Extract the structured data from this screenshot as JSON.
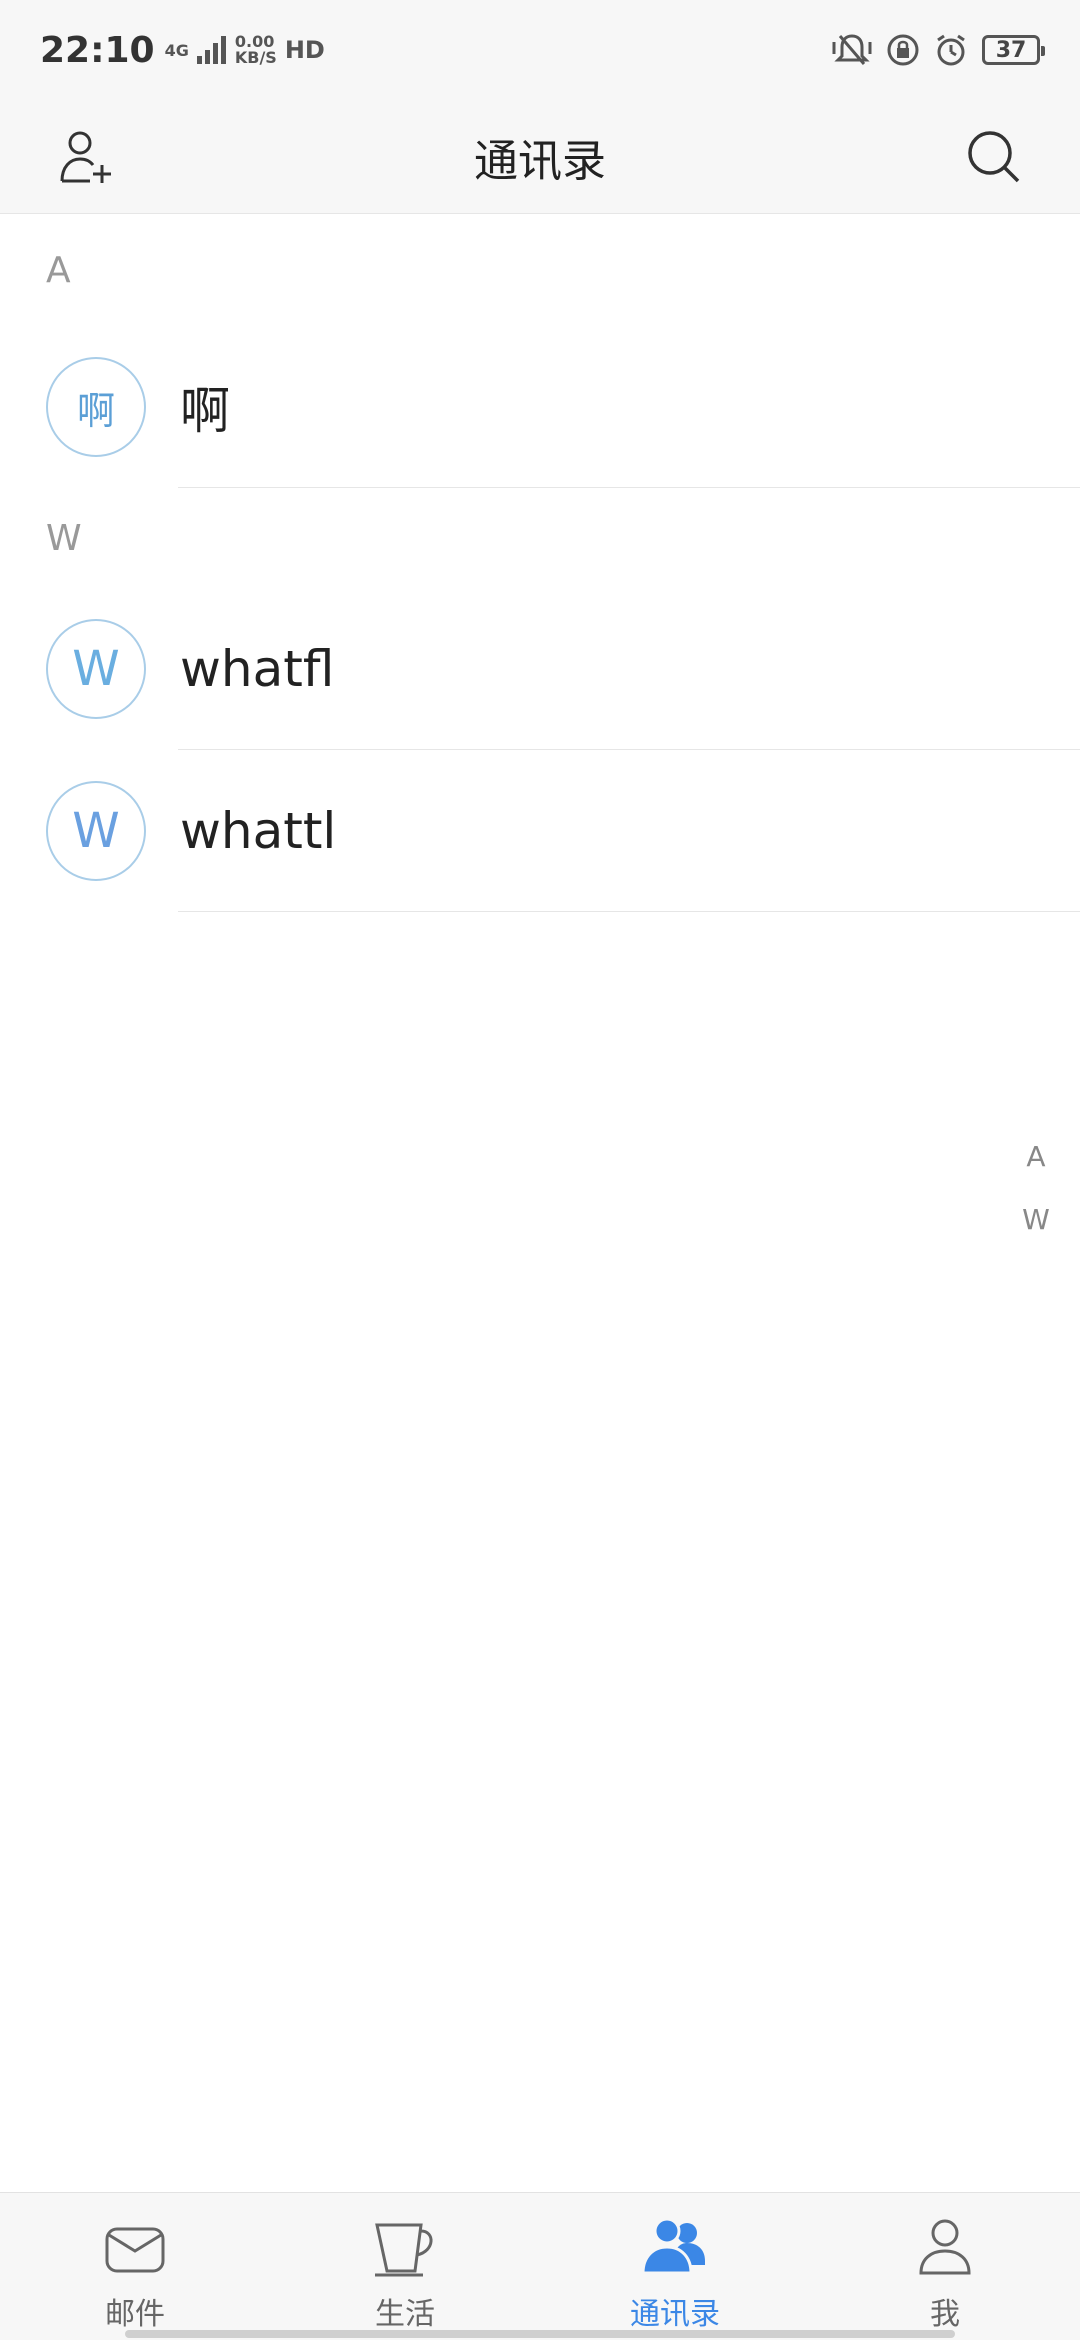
{
  "status_bar": {
    "time": "22:10",
    "network": "4G",
    "speed_value": "0.00",
    "speed_unit": "KB/S",
    "hd": "HD",
    "battery": "37"
  },
  "header": {
    "title": "通讯录",
    "add_contact_icon": "add-person-icon",
    "search_icon": "search-icon"
  },
  "contacts": {
    "sections": [
      {
        "letter": "A",
        "items": [
          {
            "avatar": "啊",
            "name": "啊"
          }
        ]
      },
      {
        "letter": "W",
        "items": [
          {
            "avatar": "W",
            "name": "whatfl"
          },
          {
            "avatar": "W",
            "name": "whattl"
          }
        ]
      }
    ]
  },
  "index_bar": [
    "A",
    "W"
  ],
  "bottom_nav": {
    "items": [
      {
        "label": "邮件",
        "icon": "mail-icon"
      },
      {
        "label": "生活",
        "icon": "cup-icon"
      },
      {
        "label": "通讯录",
        "icon": "contacts-icon",
        "active": true
      },
      {
        "label": "我",
        "icon": "person-icon"
      }
    ]
  },
  "colors": {
    "accent": "#3b87e6",
    "avatar_border": "#a9cde8",
    "avatar_text": "#5b9fd6"
  }
}
